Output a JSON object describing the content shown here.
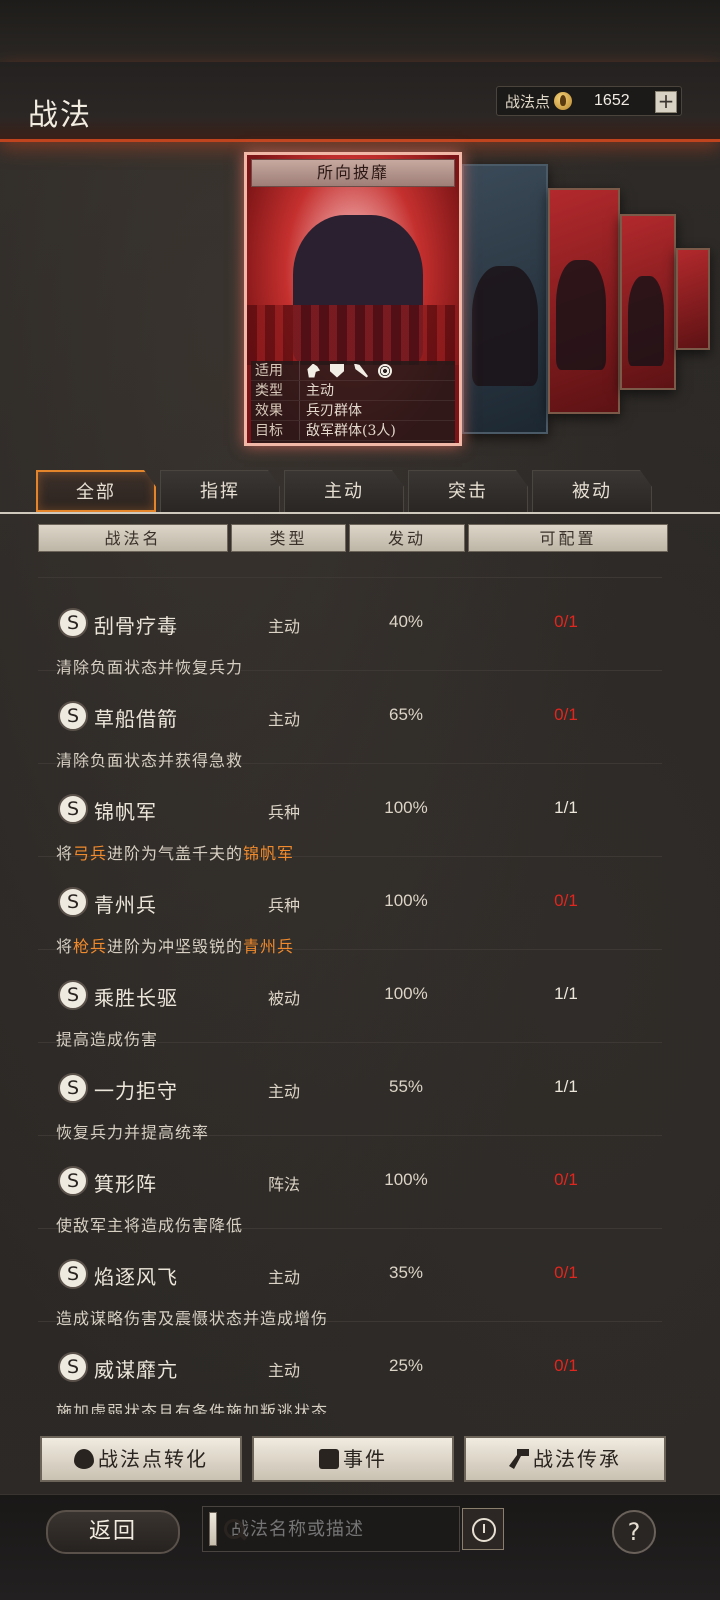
{
  "header": {
    "title": "战法",
    "points_label": "战法点",
    "points_value": "1652",
    "plus_label": "+"
  },
  "featured_card": {
    "title": "所向披靡",
    "info": [
      {
        "key": "适用",
        "value": ""
      },
      {
        "key": "类型",
        "value": "主动"
      },
      {
        "key": "效果",
        "value": "兵刃群体"
      },
      {
        "key": "目标",
        "value": "敌军群体(3人)"
      }
    ],
    "unit_icons": [
      "horse-icon",
      "shield-icon",
      "bow-icon",
      "wheel-icon"
    ]
  },
  "tabs": [
    {
      "label": "全部",
      "active": true
    },
    {
      "label": "指挥",
      "active": false
    },
    {
      "label": "主动",
      "active": false
    },
    {
      "label": "突击",
      "active": false
    },
    {
      "label": "被动",
      "active": false
    }
  ],
  "table_headers": {
    "name": "战法名",
    "type": "类型",
    "trigger": "发动",
    "config": "可配置"
  },
  "skills": [
    {
      "badge": "S",
      "name": "刮骨疗毒",
      "type": "主动",
      "rate": "40%",
      "config": "0/1",
      "config_color": "red",
      "desc": "清除负面状态并恢复兵力"
    },
    {
      "badge": "S",
      "name": "草船借箭",
      "type": "主动",
      "rate": "65%",
      "config": "0/1",
      "config_color": "red",
      "desc": "清除负面状态并获得急救"
    },
    {
      "badge": "S",
      "name": "锦帆军",
      "type": "兵种",
      "rate": "100%",
      "config": "1/1",
      "config_color": "white",
      "desc_parts": [
        "将",
        "弓兵",
        "进阶为气盖千夫的",
        "锦帆军"
      ]
    },
    {
      "badge": "S",
      "name": "青州兵",
      "type": "兵种",
      "rate": "100%",
      "config": "0/1",
      "config_color": "red",
      "desc_parts": [
        "将",
        "枪兵",
        "进阶为冲坚毁锐的",
        "青州兵"
      ]
    },
    {
      "badge": "S",
      "name": "乘胜长驱",
      "type": "被动",
      "rate": "100%",
      "config": "1/1",
      "config_color": "white",
      "desc": "提高造成伤害"
    },
    {
      "badge": "S",
      "name": "一力拒守",
      "type": "主动",
      "rate": "55%",
      "config": "1/1",
      "config_color": "white",
      "desc": "恢复兵力并提高统率"
    },
    {
      "badge": "S",
      "name": "箕形阵",
      "type": "阵法",
      "rate": "100%",
      "config": "0/1",
      "config_color": "red",
      "desc": "使敌军主将造成伤害降低"
    },
    {
      "badge": "S",
      "name": "焰逐风飞",
      "type": "主动",
      "rate": "35%",
      "config": "0/1",
      "config_color": "red",
      "desc": "造成谋略伤害及震慑状态并造成增伤"
    },
    {
      "badge": "S",
      "name": "威谋靡亢",
      "type": "主动",
      "rate": "25%",
      "config": "0/1",
      "config_color": "red",
      "desc": "施加虚弱状态且有条件施加叛逃状态"
    }
  ],
  "buttons": {
    "convert": "战法点转化",
    "event": "事件",
    "inherit": "战法传承"
  },
  "bottom": {
    "back": "返回",
    "search_placeholder": "战法名称或描述",
    "help": "?"
  },
  "colors": {
    "accent_orange": "#e4852c",
    "config_red": "#e0261e",
    "highlight": "#f08a2c"
  }
}
